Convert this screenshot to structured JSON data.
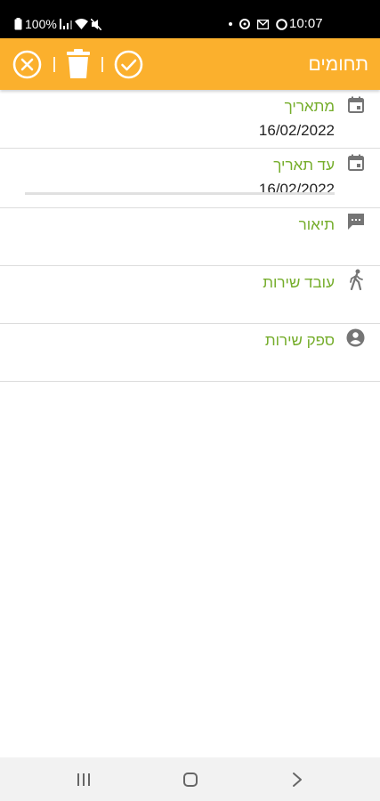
{
  "status_bar": {
    "battery_text": "100%",
    "time": "10:07"
  },
  "app_bar": {
    "title": "תחומים"
  },
  "fields": [
    {
      "label": "מתאריך",
      "value": "16/02/2022",
      "icon": "calendar-icon"
    },
    {
      "label": "עד תאריך",
      "value": "16/02/2022",
      "icon": "calendar-icon"
    },
    {
      "label": "תיאור",
      "value": "",
      "icon": "comment-icon"
    },
    {
      "label": "עובד שירות",
      "value": "",
      "icon": "walking-person-icon"
    },
    {
      "label": "ספק שירות",
      "value": "",
      "icon": "account-circle-icon"
    }
  ],
  "colors": {
    "accent": "#fbb02d",
    "label_green": "#75ad2b",
    "icon_gray": "#757575"
  }
}
